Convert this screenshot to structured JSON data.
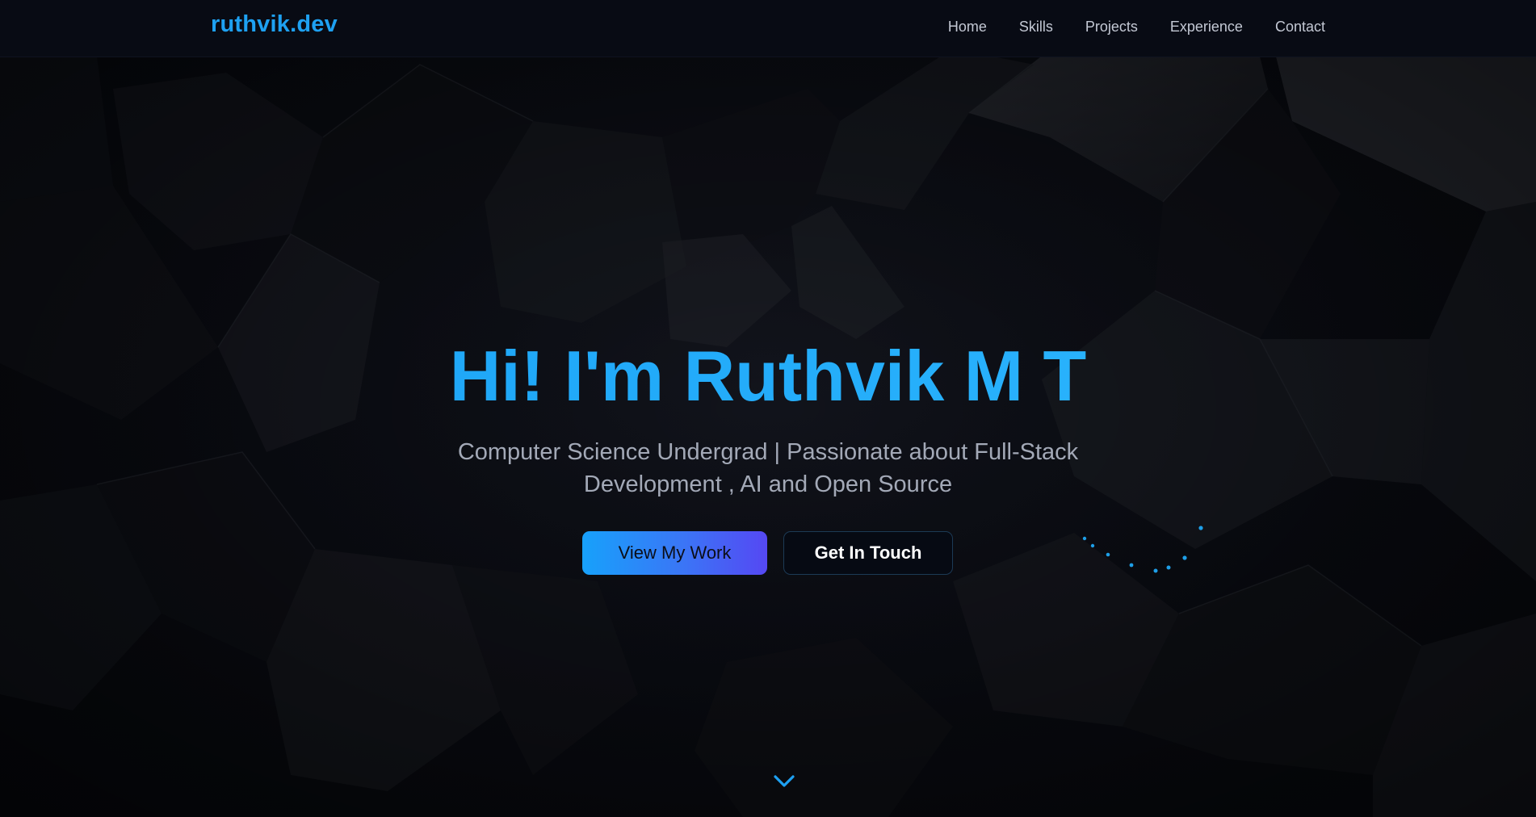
{
  "navbar": {
    "logo": "ruthvik.dev",
    "links": [
      "Home",
      "Skills",
      "Projects",
      "Experience",
      "Contact"
    ]
  },
  "hero": {
    "title": "Hi! I'm Ruthvik M T",
    "subtitle": "Computer Science Undergrad | Passionate about Full-Stack Development , AI and Open Source",
    "primary_button": "View My Work",
    "secondary_button": "Get In Touch"
  },
  "icons": {
    "scroll": "chevron-down-icon",
    "loader": "loading-dots-icon"
  },
  "colors": {
    "accent": "#1ea1f2",
    "background": "#07090f",
    "button_gradient_start": "#17a1fb",
    "button_gradient_end": "#5548f3",
    "nav_text": "#c3c8d4",
    "subtitle_text": "#a3a9b7"
  }
}
